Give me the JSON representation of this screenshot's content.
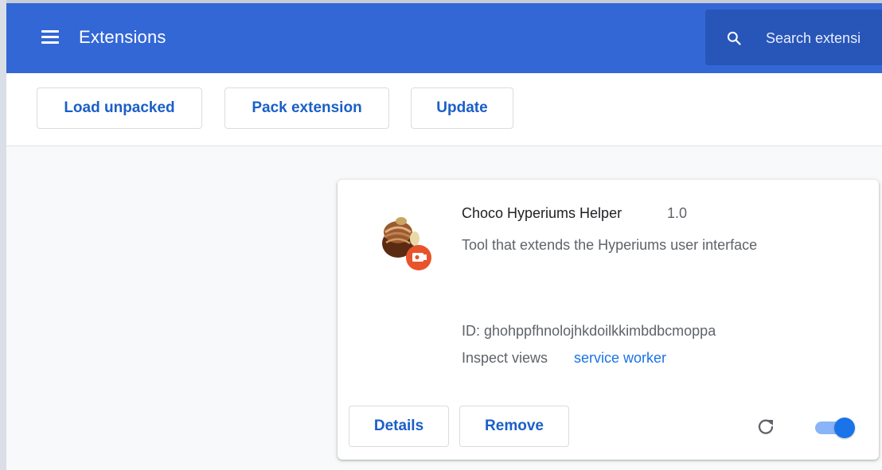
{
  "header": {
    "title": "Extensions",
    "search_placeholder": "Search extensi"
  },
  "toolbar": {
    "load_unpacked": "Load unpacked",
    "pack_extension": "Pack extension",
    "update": "Update"
  },
  "extension": {
    "name": "Choco Hyperiums Helper",
    "version": "1.0",
    "description": "Tool that extends the Hyperiums user interface",
    "id_text": "ID: ghohppfhnolojhkdoilkkimbdbcmoppa",
    "inspect_label": "Inspect views",
    "inspect_link": "service worker",
    "details_label": "Details",
    "remove_label": "Remove",
    "enabled": true
  },
  "colors": {
    "header_bg": "#3367d6",
    "search_bg": "#2855b8",
    "accent": "#1a73e8",
    "toggle_track": "#8ab4f8",
    "badge": "#e8532b"
  },
  "icons": {
    "menu": "hamburger-menu-icon",
    "search": "search-icon",
    "reload": "reload-icon",
    "extension": "chocolate-truffle-icon",
    "badge": "unpacked-badge-icon"
  }
}
